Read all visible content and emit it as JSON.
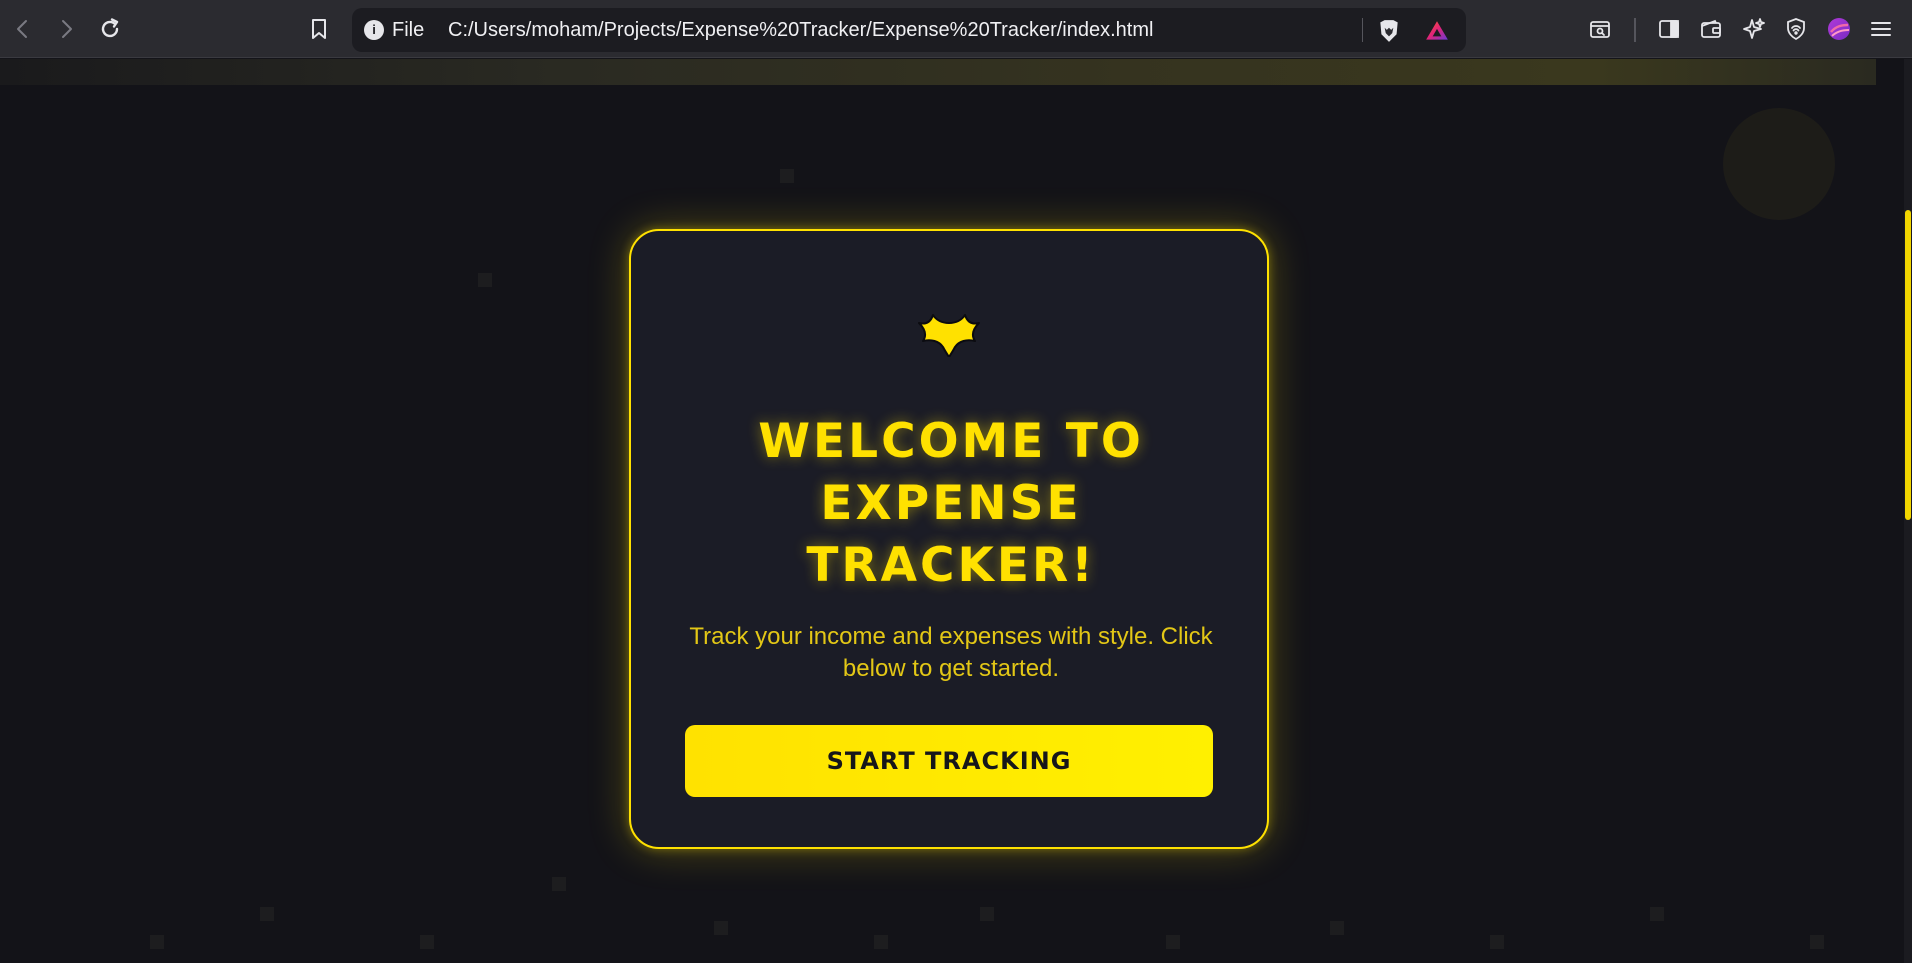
{
  "browser": {
    "url_scheme": "File",
    "url_path": "C:/Users/moham/Projects/Expense%20Tracker/Expense%20Tracker/index.html",
    "info_glyph": "i",
    "icons": {
      "back": "back-arrow-icon",
      "forward": "forward-arrow-icon",
      "reload": "reload-icon",
      "bookmark": "bookmark-icon",
      "shields": "brave-shields-icon",
      "rewards": "brave-rewards-icon",
      "search_page": "search-in-page-icon",
      "sidebar": "sidebar-icon",
      "wallet": "wallet-icon",
      "leo": "leo-ai-icon",
      "vpn": "vpn-icon",
      "profile": "profile-avatar-icon",
      "menu": "hamburger-menu-icon"
    },
    "colors": {
      "toolbar": "#2b2b30",
      "urlbar": "#1c1c21"
    }
  },
  "page": {
    "title": "WELCOME TO EXPENSE TRACKER!",
    "subtitle": "Track your income and expenses with style. Click below to get started.",
    "start_button": "START TRACKING",
    "logo_icon": "bat-logo-icon",
    "colors": {
      "accent": "#ffe100",
      "card_bg": "#1b1c26",
      "page_bg": "#131318"
    }
  }
}
